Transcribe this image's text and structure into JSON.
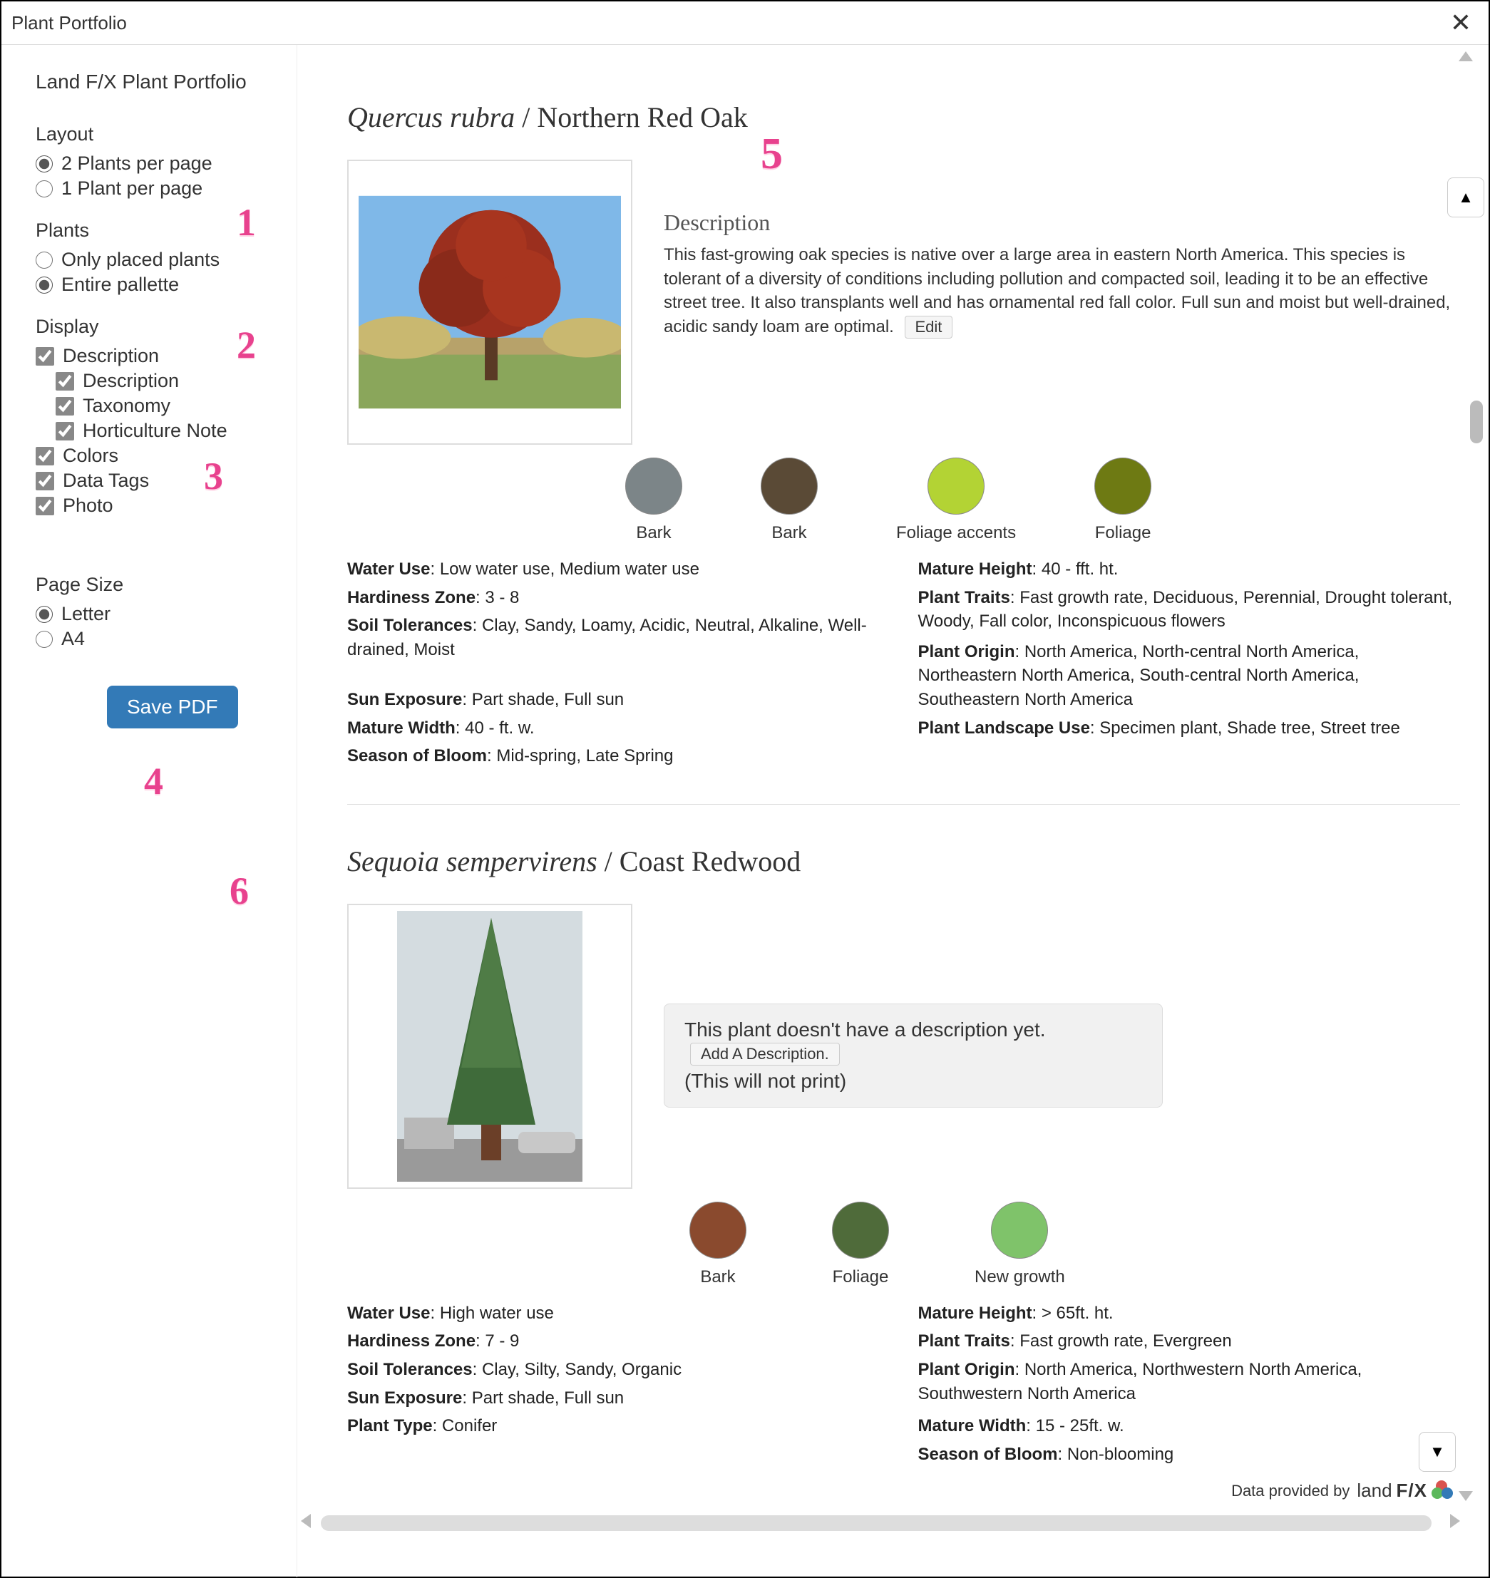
{
  "window": {
    "title": "Plant Portfolio"
  },
  "sidebar": {
    "title": "Land F/X Plant Portfolio",
    "layout": {
      "label": "Layout",
      "options": [
        "2 Plants per page",
        "1 Plant per page"
      ]
    },
    "plants": {
      "label": "Plants",
      "options": [
        "Only placed plants",
        "Entire pallette"
      ]
    },
    "display": {
      "label": "Display",
      "options": {
        "description": "Description",
        "description_sub": "Description",
        "taxonomy": "Taxonomy",
        "hortnote": "Horticulture Note",
        "colors": "Colors",
        "datatags": "Data Tags",
        "photo": "Photo"
      }
    },
    "pagesize": {
      "label": "Page Size",
      "options": [
        "Letter",
        "A4"
      ]
    },
    "save_label": "Save PDF"
  },
  "callouts": {
    "c1": "1",
    "c2": "2",
    "c3": "3",
    "c4": "4",
    "c5": "5",
    "c6": "6"
  },
  "plant1": {
    "sci": "Quercus rubra",
    "sep": " / ",
    "common": "Northern Red Oak",
    "desc_header": "Description",
    "desc_text": "This fast-growing oak species is native over a large area in eastern North America. This species is tolerant of a diversity of conditions including pollution and compacted soil, leading it to be an effective street tree. It also transplants well and has ornamental red fall color. Full sun and moist but well-drained, acidic sandy loam are optimal.",
    "edit_label": "Edit",
    "swatches": [
      {
        "label": "Bark",
        "color": "#7c8588"
      },
      {
        "label": "Bark",
        "color": "#5a4a36"
      },
      {
        "label": "Foliage accents",
        "color": "#b3d334"
      },
      {
        "label": "Foliage",
        "color": "#6e7a13"
      }
    ],
    "left": {
      "water_use_k": "Water Use",
      "water_use_v": ": Low water use, Medium water use",
      "hardiness_k": "Hardiness Zone",
      "hardiness_v": ": 3 - 8",
      "soil_k": "Soil Tolerances",
      "soil_v": ": Clay, Sandy, Loamy, Acidic, Neutral, Alkaline, Well-drained, Moist",
      "sun_k": "Sun Exposure",
      "sun_v": ": Part shade, Full sun",
      "land_k": "Plant Landscape Use",
      "land_v": ": Specimen plant, Shade tree, Street tree"
    },
    "right": {
      "height_k": "Mature Height",
      "height_v": ": 40 - fft. ht.",
      "traits_k": "Plant Traits",
      "traits_v": ": Fast growth rate, Deciduous, Perennial, Drought tolerant, Woody, Fall color, Inconspicuous flowers",
      "origin_k": "Plant Origin",
      "origin_v": ": North America, North-central North America, Northeastern North America, South-central North America, Southeastern North America",
      "width_k": "Mature Width",
      "width_v": ": 40 - ft. w.",
      "bloom_k": "Season of Bloom",
      "bloom_v": ": Mid-spring, Late Spring"
    }
  },
  "plant2": {
    "sci": "Sequoia sempervirens",
    "sep": " / ",
    "common": "Coast Redwood",
    "nodesc_line1": "This plant doesn't have a description yet.",
    "nodesc_line2": "(This will not print)",
    "add_desc_label": "Add A Description.",
    "swatches": [
      {
        "label": "Bark",
        "color": "#8a4a2e"
      },
      {
        "label": "Foliage",
        "color": "#4f6b3a"
      },
      {
        "label": "New growth",
        "color": "#7fc36a"
      }
    ],
    "left": {
      "water_use_k": "Water Use",
      "water_use_v": ": High water use",
      "hardiness_k": "Hardiness Zone",
      "hardiness_v": ": 7 - 9",
      "soil_k": "Soil Tolerances",
      "soil_v": ": Clay, Silty, Sandy, Organic",
      "sun_k": "Sun Exposure",
      "sun_v": ": Part shade, Full sun",
      "type_k": "Plant Type",
      "type_v": ": Conifer"
    },
    "right": {
      "height_k": "Mature Height",
      "height_v": ": > 65ft. ht.",
      "traits_k": "Plant Traits",
      "traits_v": ": Fast growth rate, Evergreen",
      "origin_k": "Plant Origin",
      "origin_v": ": North America, Northwestern North America, Southwestern North America",
      "width_k": "Mature Width",
      "width_v": ": 15 - 25ft. w.",
      "bloom_k": "Season of Bloom",
      "bloom_v": ": Non-blooming"
    }
  },
  "footer": {
    "label": "Data provided by",
    "brand_pre": "land ",
    "brand_bold": "F/X"
  }
}
